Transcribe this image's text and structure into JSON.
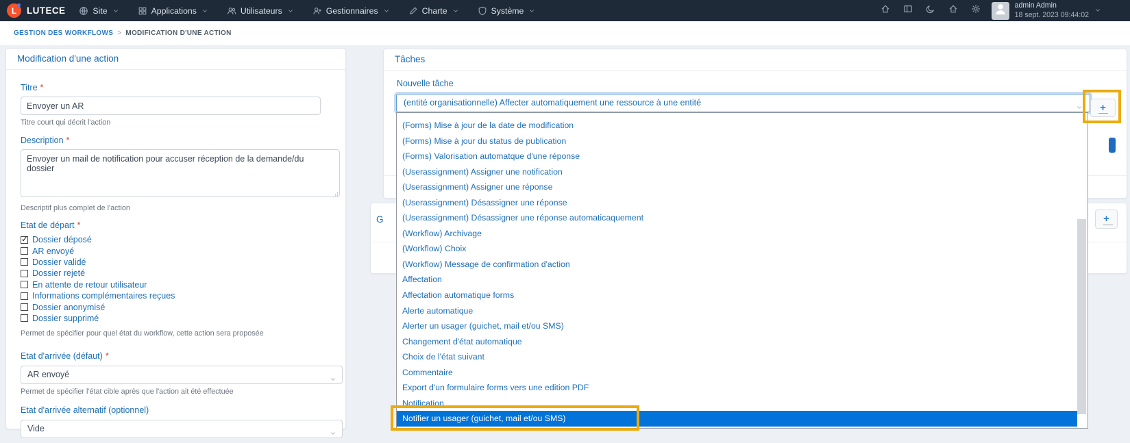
{
  "colors": {
    "accent": "#1d6fb5",
    "selection_blue": "#0273d8",
    "annotation_yellow": "#ecab0e",
    "navbar_bg": "#1e2a38"
  },
  "navbar": {
    "brand": "LUTECE",
    "brand_initial": "L",
    "menus": [
      {
        "label": "Site",
        "icon": "globe-icon"
      },
      {
        "label": "Applications",
        "icon": "grid-icon"
      },
      {
        "label": "Utilisateurs",
        "icon": "users-icon"
      },
      {
        "label": "Gestionnaires",
        "icon": "manager-icon"
      },
      {
        "label": "Charte",
        "icon": "pen-icon"
      },
      {
        "label": "Système",
        "icon": "shield-icon"
      }
    ],
    "quick_icons": [
      {
        "name": "home-icon"
      },
      {
        "name": "layout-icon"
      },
      {
        "name": "moon-icon"
      },
      {
        "name": "site-home-icon"
      },
      {
        "name": "settings-icon"
      }
    ],
    "user": {
      "name": "admin Admin",
      "datetime": "18 sept. 2023 09:44:02"
    }
  },
  "breadcrumb": {
    "section": "GESTION DES WORKFLOWS",
    "separator": ">",
    "page": "MODIFICATION D'UNE ACTION"
  },
  "action_form": {
    "title": "Modification d'une action",
    "titre": {
      "label": "Titre",
      "required": "*",
      "value": "Envoyer un AR",
      "help": "Titre court qui décrit l'action"
    },
    "description": {
      "label": "Description",
      "required": "*",
      "value": "Envoyer un mail de notification pour accuser réception de la demande/du dossier",
      "help": "Descriptif plus complet de l'action"
    },
    "etat_depart": {
      "label": "Etat de départ",
      "required": "*",
      "help": "Permet de spécifier pour quel état du workflow, cette action sera proposée",
      "options": [
        {
          "label": "Dossier déposé",
          "checked": true
        },
        {
          "label": "AR envoyé",
          "checked": false
        },
        {
          "label": "Dossier validé",
          "checked": false
        },
        {
          "label": "Dossier rejeté",
          "checked": false
        },
        {
          "label": "En attente de retour utilisateur",
          "checked": false
        },
        {
          "label": "Informations complémentaires reçues",
          "checked": false
        },
        {
          "label": "Dossier anonymisé",
          "checked": false
        },
        {
          "label": "Dossier supprimé",
          "checked": false
        }
      ]
    },
    "etat_arrivee": {
      "label": "Etat d'arrivée (défaut)",
      "required": "*",
      "value": "AR envoyé",
      "help": "Permet de spécifier l'état cible après que l'action ait été effectuée"
    },
    "etat_alternatif": {
      "label": "Etat d'arrivée alternatif (optionnel)",
      "value": "Vide"
    }
  },
  "tasks_panel": {
    "title": "Tâches",
    "new_task_label": "Nouvelle tâche",
    "selected_task": "(entité organisationnelle) Affecter automatiquement une ressource à une entité",
    "add_button_label": "+",
    "dropdown_items": [
      {
        "label": "(Forms) Mise à jour de la date de modification"
      },
      {
        "label": "(Forms) Mise à jour du status de publication"
      },
      {
        "label": "(Forms) Valorisation automatque d'une réponse"
      },
      {
        "label": "(Userassignment) Assigner une notification"
      },
      {
        "label": "(Userassignment) Assigner une réponse"
      },
      {
        "label": "(Userassignment) Désassigner une réponse"
      },
      {
        "label": "(Userassignment) Désassigner une réponse automaticaquement"
      },
      {
        "label": "(Workflow) Archivage"
      },
      {
        "label": "(Workflow) Choix"
      },
      {
        "label": "(Workflow) Message de confirmation d'action"
      },
      {
        "label": "Affectation"
      },
      {
        "label": "Affectation automatique forms"
      },
      {
        "label": "Alerte automatique"
      },
      {
        "label": "Alerter un usager (guichet, mail et/ou SMS)"
      },
      {
        "label": "Changement d'état automatique"
      },
      {
        "label": "Choix de l'état suivant"
      },
      {
        "label": "Commentaire"
      },
      {
        "label": "Export d'un formulaire forms vers une edition PDF"
      },
      {
        "label": "Notification"
      },
      {
        "label": "Notifier un usager (guichet, mail et/ou SMS)",
        "selected": true
      }
    ]
  },
  "second_panel": {
    "visible_header_text": "G",
    "add_button_label": "+"
  }
}
